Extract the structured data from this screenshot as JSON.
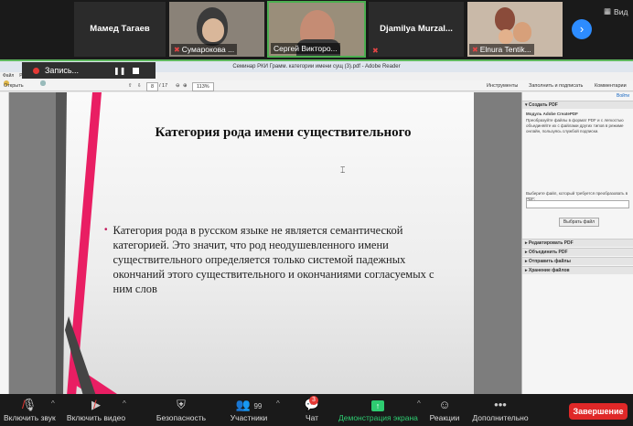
{
  "participants": [
    {
      "name": "Мамед Тагаев",
      "video": false
    },
    {
      "label": "Сумарокова ...",
      "video": true,
      "muted": true
    },
    {
      "label": "Сергей Викторо...",
      "video": true,
      "muted": false,
      "active": true
    },
    {
      "name": "Djamilya Murzal...",
      "video": false,
      "muted": true
    },
    {
      "label": "Elnura Tentik...",
      "video": true,
      "muted": true
    }
  ],
  "view_label": "Вид",
  "recording": {
    "label": "Запись..."
  },
  "acrobat": {
    "window_title": "Семинар РКИ Грамм. категории имени сущ (3).pdf - Adobe Reader",
    "menu": [
      "Файл",
      "Редактирование",
      "Просмотр",
      "Окно",
      "Справка"
    ],
    "open_label": "Открыть",
    "page_current": "8",
    "page_total": "/ 17",
    "zoom": "113%",
    "right_tabs": [
      "Инструменты",
      "Заполнить и подписать",
      "Комментарии"
    ],
    "panel": {
      "signin": "Войти",
      "create_pdf": "Создать PDF",
      "module_title": "Модуль Adobe CreatePDF",
      "module_text": "Преобразуйте файлы в формат PDF и с легкостью объединяйте их с файлами других типов в режиме онлайн, пользуясь службой подписки.",
      "select_label": "Выберите файл, который требуется преобразовать в PDF:",
      "select_button": "Выбрать файл",
      "sections": [
        "Редактировать PDF",
        "Объединить PDF",
        "Отправить файлы",
        "Хранение файлов"
      ]
    }
  },
  "slide": {
    "title": "Категория  рода имени существительного",
    "bullet": "Категория рода в русском языке не является семантической категорией. Это значит, что род неодушевленного имени существительного определяется только системой падежных окончаний этого существительного и окончаниями согласуемых с ним слов"
  },
  "toolbar": {
    "mute": "Включить звук",
    "video": "Включить видео",
    "security": "Безопасность",
    "participants": "Участники",
    "participants_count": "99",
    "chat": "Чат",
    "chat_badge": "3",
    "share": "Демонстрация экрана",
    "reactions": "Реакции",
    "more": "Дополнительно",
    "end": "Завершение"
  },
  "colors": {
    "accent_green": "#2ecc71",
    "end_red": "#e02828",
    "slide_pink": "#e91e63"
  }
}
